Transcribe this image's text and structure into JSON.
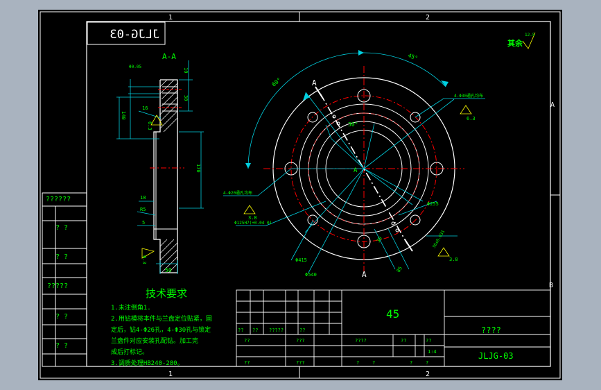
{
  "colors": {
    "background": "#a9b3bf",
    "sheet": "#000000",
    "border": "#ffffff",
    "green": "#00ff00",
    "cyan": "#00d0e0",
    "red": "#ff0000",
    "yellow": "#ffff00"
  },
  "drawing": {
    "mirrored_code": "JLJG-03",
    "section_label": "A-A",
    "zone_top_1": "1",
    "zone_top_2": "2",
    "zone_bottom_1": "1",
    "zone_bottom_2": "2",
    "zone_right_a": "A",
    "zone_right_b": "B",
    "roughness_note": "其余",
    "roughness_value": "12.5",
    "section_dims": {
      "d1": "10",
      "d2": "30",
      "d3": "16",
      "d4": "140",
      "d5": "170",
      "d6": "18",
      "d7": "R5",
      "d8": "5",
      "d9": "0.3",
      "d10": "50",
      "d11": "Φ0.05",
      "d12": "6.3"
    },
    "plan_dims": {
      "angle_left": "60°",
      "angle_right": "45°",
      "angle_inner": "30°",
      "holes_top": "4-Φ30通孔均布",
      "holes_top_roughness": "6.3",
      "holes_left": "4-Φ20通孔均布",
      "holes_left_roughness": "3.8",
      "bore_note": "Φ125H7(+0.04 0)",
      "dia_255": "Φ255",
      "dia_415": "Φ415",
      "dia_540": "Φ540",
      "dim_30": "30",
      "dim_36": "36±0.031",
      "dim_36_roughness": "3.8",
      "dim_85": "85",
      "section_mark_a1": "A",
      "section_mark_a2": "A",
      "center_label": "A"
    }
  },
  "left_table": {
    "rows": [
      "??????",
      "? ?",
      "? ?",
      "?????",
      "? ?",
      "? ?"
    ]
  },
  "tech": {
    "title": "技术要求",
    "lines": [
      "1.未注倒角1.",
      "2.用钻模将本件与兰盘定位贴紧，固",
      "定后，钻4-Φ26孔，4-Φ30孔与锁定",
      "兰盘件对应安装孔配钻。加工完",
      "成后打标记。",
      "3.调质处理HB240-280。"
    ]
  },
  "title_block": {
    "material": "45",
    "part_name": "????",
    "drawing_no": "JLJG-03",
    "row_a": [
      "??",
      "??",
      "?????",
      "??"
    ],
    "row_b": [
      "??",
      "???"
    ],
    "row_c": [
      "??",
      "???"
    ],
    "cells": [
      "????",
      "??",
      "??",
      "1:4"
    ],
    "bottom": [
      "?",
      "?",
      "?",
      "?"
    ]
  }
}
